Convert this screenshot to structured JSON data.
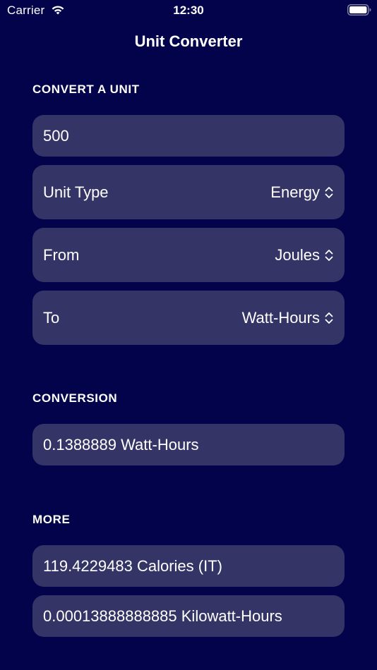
{
  "status_bar": {
    "carrier": "Carrier",
    "time": "12:30"
  },
  "nav": {
    "title": "Unit Converter"
  },
  "convert_section": {
    "header": "CONVERT A UNIT",
    "amount_value": "500",
    "unit_type": {
      "label": "Unit Type",
      "value": "Energy"
    },
    "from": {
      "label": "From",
      "value": "Joules"
    },
    "to": {
      "label": "To",
      "value": "Watt-Hours"
    }
  },
  "conversion_section": {
    "header": "CONVERSION",
    "result": "0.1388889 Watt-Hours"
  },
  "more_section": {
    "header": "MORE",
    "items": [
      "119.4229483 Calories (IT)",
      "0.00013888888885 Kilowatt-Hours"
    ]
  },
  "colors": {
    "background": "#02034a",
    "cell": "#343466",
    "text": "#ffffff"
  }
}
